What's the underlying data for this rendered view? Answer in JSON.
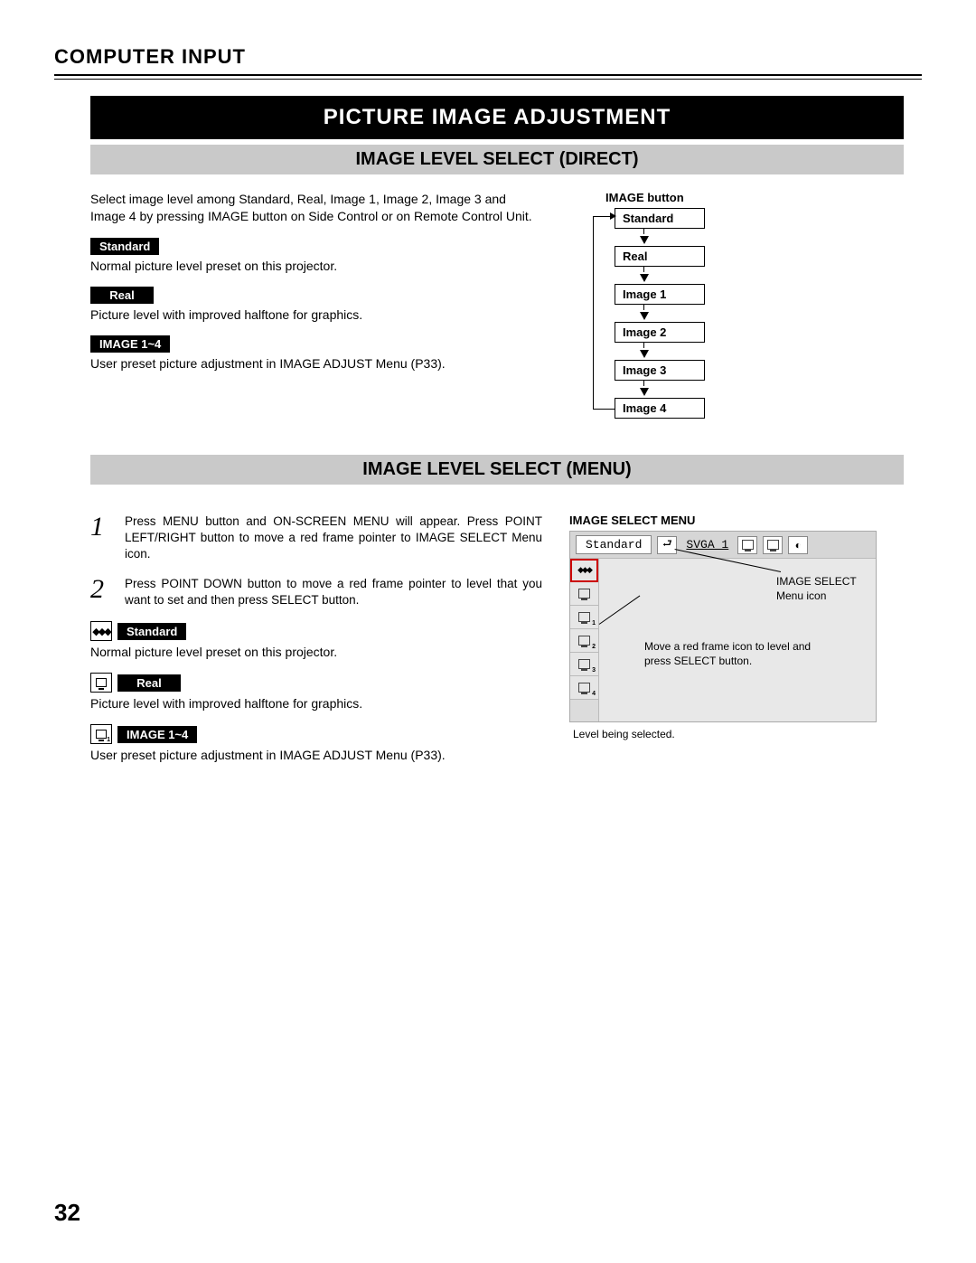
{
  "header": "COMPUTER INPUT",
  "title": "PICTURE IMAGE ADJUSTMENT",
  "section1": {
    "heading": "IMAGE LEVEL SELECT (DIRECT)",
    "intro": "Select image level among Standard, Real, Image 1, Image 2, Image 3 and Image 4 by pressing IMAGE button on Side Control or on Remote Control Unit.",
    "items": [
      {
        "label": "Standard",
        "desc": "Normal picture level preset on this projector."
      },
      {
        "label": "Real",
        "desc": "Picture level with improved halftone for graphics."
      },
      {
        "label": "IMAGE 1~4",
        "desc": "User preset picture adjustment in IMAGE ADJUST Menu (P33)."
      }
    ],
    "flow": {
      "heading": "IMAGE button",
      "steps": [
        "Standard",
        "Real",
        "Image 1",
        "Image 2",
        "Image 3",
        "Image 4"
      ]
    }
  },
  "section2": {
    "heading": "IMAGE LEVEL SELECT (MENU)",
    "steps": [
      {
        "n": "1",
        "text": "Press MENU button and ON-SCREEN MENU will appear.  Press POINT LEFT/RIGHT button to move a red frame pointer to IMAGE SELECT Menu icon."
      },
      {
        "n": "2",
        "text": "Press POINT DOWN button to move a red frame pointer to level that you want to set and then press SELECT button."
      }
    ],
    "items": [
      {
        "label": "Standard",
        "desc": "Normal picture level preset on this projector."
      },
      {
        "label": "Real",
        "desc": "Picture level with improved halftone for graphics."
      },
      {
        "label": "IMAGE 1~4",
        "desc": "User preset picture adjustment in IMAGE ADJUST Menu (P33)."
      }
    ],
    "menu": {
      "heading": "IMAGE SELECT MENU",
      "mode": "Standard",
      "signal": "SVGA 1",
      "callout_icon": "IMAGE SELECT Menu icon",
      "callout_move": "Move a red frame icon to level and press SELECT button.",
      "callout_selected": "Level being selected."
    }
  },
  "page": "32"
}
